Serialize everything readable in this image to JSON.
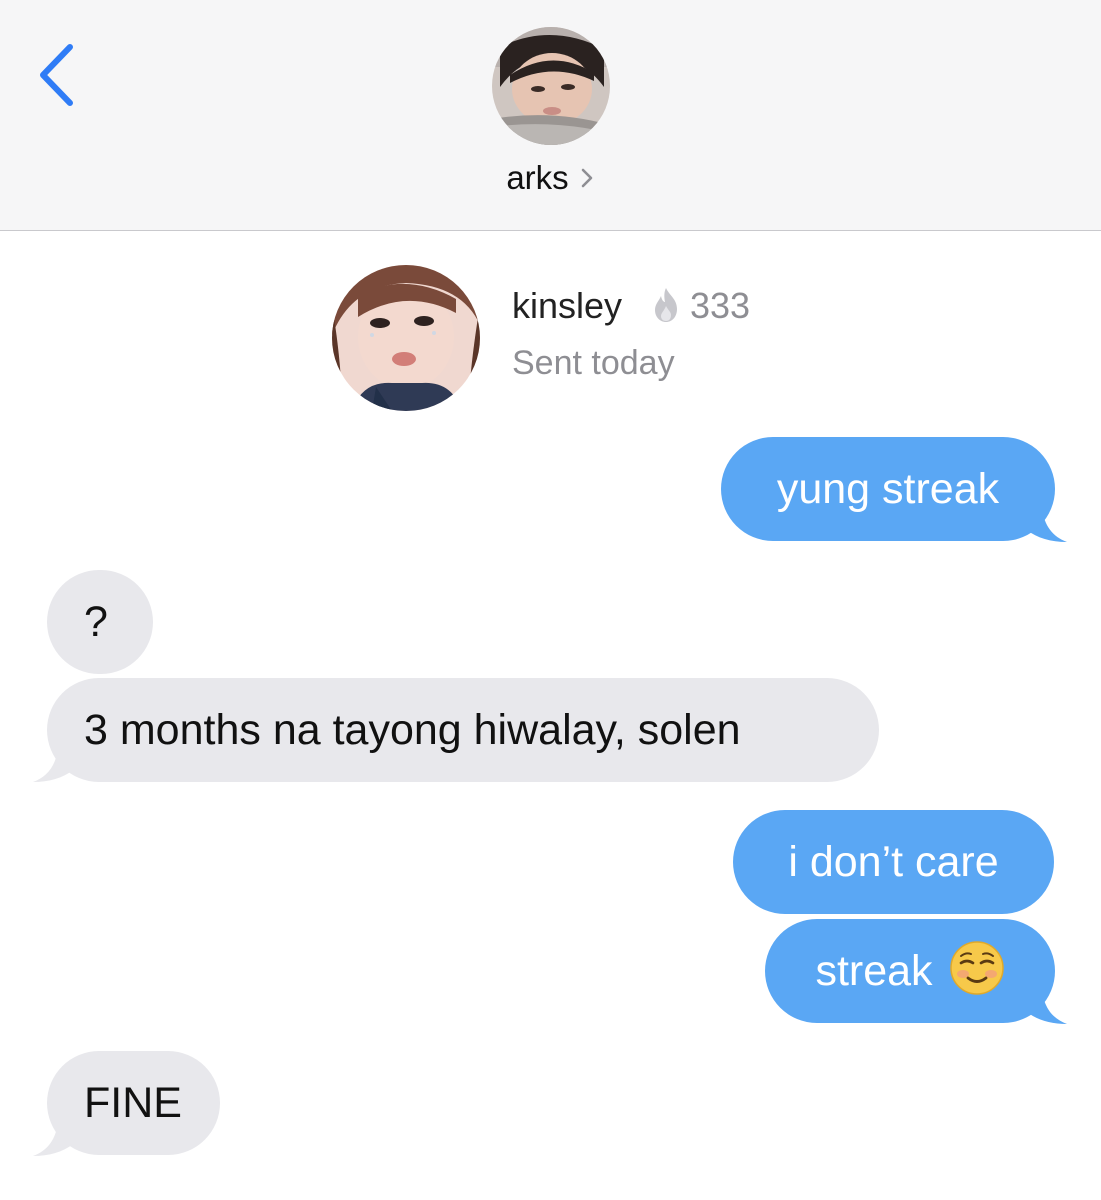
{
  "header": {
    "contact_name": "arks",
    "back_icon": "chevron-left-icon",
    "disclosure_icon": "chevron-right-icon",
    "accent_color": "#2f7cf6"
  },
  "attachment": {
    "username": "kinsley",
    "streak_icon": "flame-icon",
    "streak_count": "333",
    "subtitle": "Sent today"
  },
  "messages": [
    {
      "direction": "outgoing",
      "text": "yung streak"
    },
    {
      "direction": "incoming",
      "text": "?"
    },
    {
      "direction": "incoming",
      "text": "3 months na tayong hiwalay, solen"
    },
    {
      "direction": "outgoing",
      "text": "i don’t care"
    },
    {
      "direction": "outgoing",
      "text": "streak",
      "emoji": "smiling-face-icon"
    },
    {
      "direction": "incoming",
      "text": "FINE"
    }
  ],
  "colors": {
    "outgoing_bubble": "#5aa7f4",
    "incoming_bubble": "#e8e8ec"
  }
}
